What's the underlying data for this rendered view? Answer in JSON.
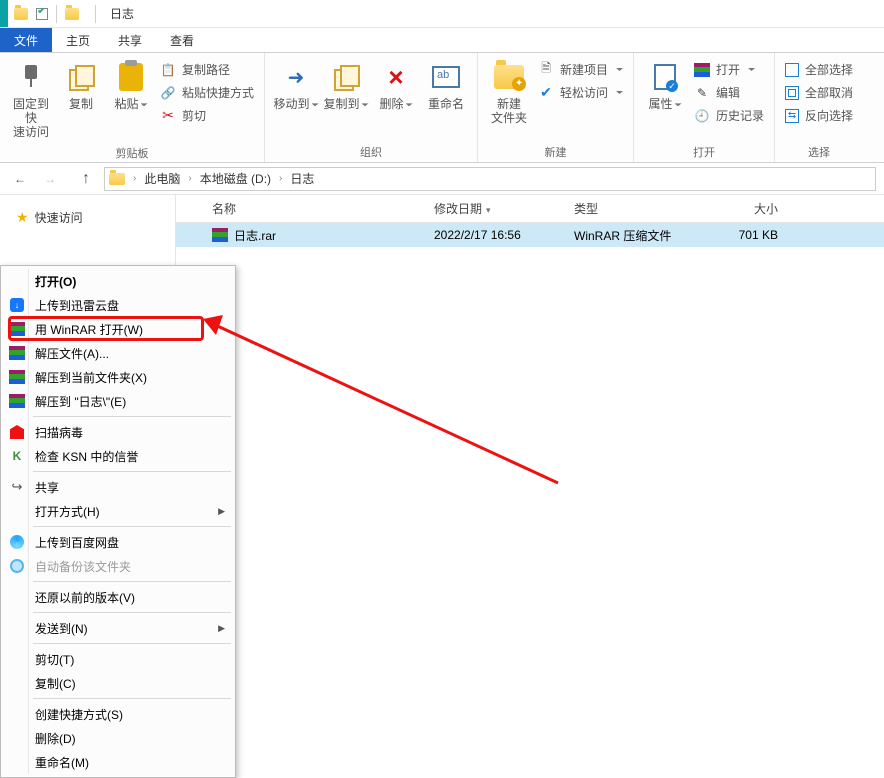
{
  "window": {
    "title": "日志"
  },
  "tabs": {
    "file": "文件",
    "home": "主页",
    "share": "共享",
    "view": "查看"
  },
  "ribbon": {
    "clipboard": {
      "label": "剪贴板",
      "pin": {
        "l1": "固定到快",
        "l2": "速访问"
      },
      "copy": "复制",
      "paste": "粘贴",
      "copypath": "复制路径",
      "pastelink": "粘贴快捷方式",
      "cut": "剪切"
    },
    "organize": {
      "label": "组织",
      "moveto": "移动到",
      "copyto": "复制到",
      "delete": "删除",
      "rename": "重命名"
    },
    "new": {
      "label": "新建",
      "newfolder": {
        "l1": "新建",
        "l2": "文件夹"
      },
      "newitem": "新建项目",
      "easyaccess": "轻松访问"
    },
    "open": {
      "label": "打开",
      "properties": "属性",
      "open": "打开",
      "edit": "编辑",
      "history": "历史记录"
    },
    "select": {
      "label": "选择",
      "all": "全部选择",
      "none": "全部取消",
      "invert": "反向选择"
    }
  },
  "path": {
    "this_pc": "此电脑",
    "drive": "本地磁盘 (D:)",
    "folder": "日志"
  },
  "sidebar": {
    "quickaccess": "快速访问"
  },
  "columns": {
    "name": "名称",
    "date": "修改日期",
    "type": "类型",
    "size": "大小"
  },
  "files": [
    {
      "name": "日志.rar",
      "date": "2022/2/17 16:56",
      "type": "WinRAR 压缩文件",
      "size": "701 KB"
    }
  ],
  "context_menu": {
    "open": "打开(O)",
    "xunlei": "上传到迅雷云盘",
    "winrar_open": "用 WinRAR 打开(W)",
    "extract_files": "解压文件(A)...",
    "extract_here": "解压到当前文件夹(X)",
    "extract_to": "解压到 \"日志\\\"(E)",
    "scan_virus": "扫描病毒",
    "ksn": "检查 KSN 中的信誉",
    "share": "共享",
    "open_with": "打开方式(H)",
    "baidu_upload": "上传到百度网盘",
    "baidu_backup": "自动备份该文件夹",
    "restore_prev": "还原以前的版本(V)",
    "send_to": "发送到(N)",
    "cut": "剪切(T)",
    "copy": "复制(C)",
    "create_shortcut": "创建快捷方式(S)",
    "delete": "删除(D)",
    "rename": "重命名(M)"
  }
}
